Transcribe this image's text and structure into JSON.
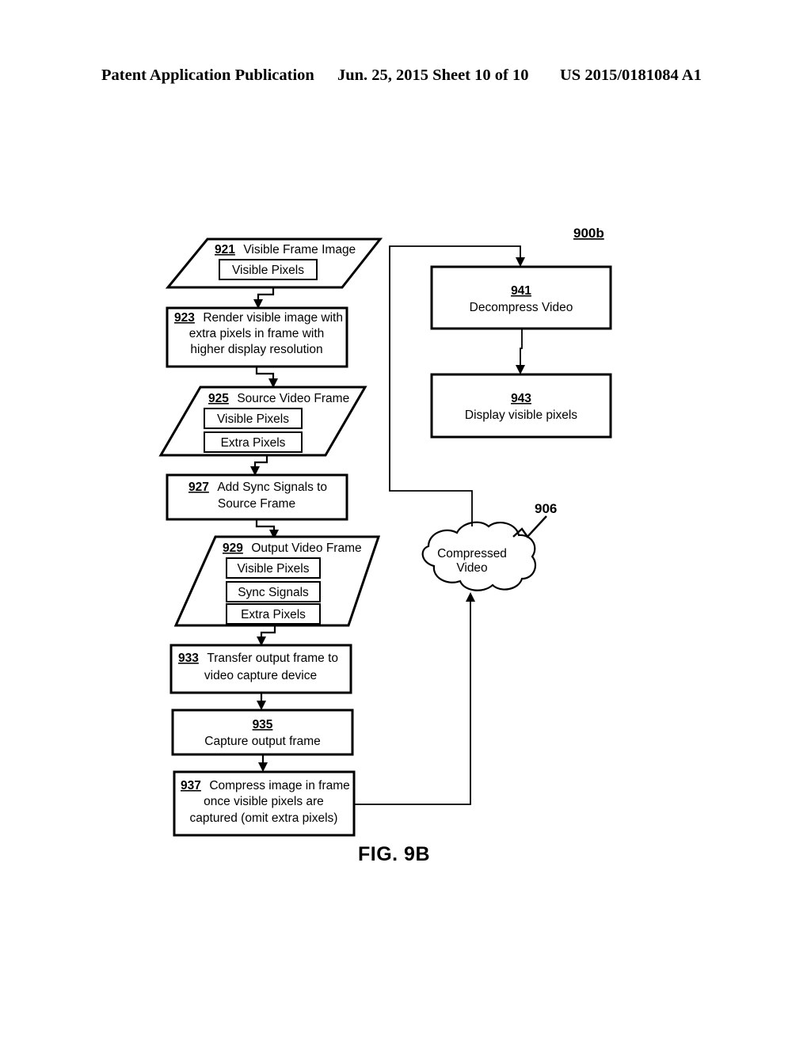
{
  "header": {
    "left": "Patent Application Publication",
    "middle": "Jun. 25, 2015  Sheet 10 of 10",
    "right": "US 2015/0181084 A1"
  },
  "figure": {
    "caption": "FIG. 9B",
    "diagram_tag": "900b",
    "cloud_tag": "906"
  },
  "nodes": {
    "n921": {
      "ref": "921",
      "title": "Visible Frame Image",
      "items": [
        "Visible Pixels"
      ]
    },
    "n923": {
      "ref": "923",
      "lines": [
        "Render visible image with",
        "extra pixels in frame with",
        "higher display resolution"
      ]
    },
    "n925": {
      "ref": "925",
      "title": "Source Video Frame",
      "items": [
        "Visible Pixels",
        "Extra Pixels"
      ]
    },
    "n927": {
      "ref": "927",
      "lines": [
        "Add Sync Signals to",
        "Source Frame"
      ]
    },
    "n929": {
      "ref": "929",
      "title": "Output Video Frame",
      "items": [
        "Visible Pixels",
        "Sync Signals",
        "Extra Pixels"
      ]
    },
    "n933": {
      "ref": "933",
      "lines": [
        "Transfer output frame to",
        "video capture device"
      ]
    },
    "n935": {
      "ref": "935",
      "lines": [
        "Capture output frame"
      ]
    },
    "n937": {
      "ref": "937",
      "lines": [
        "Compress image in frame",
        "once visible pixels are",
        "captured (omit extra pixels)"
      ]
    },
    "n941": {
      "ref": "941",
      "lines": [
        "Decompress Video"
      ]
    },
    "n943": {
      "ref": "943",
      "lines": [
        "Display visible pixels"
      ]
    },
    "cloud": {
      "lines": [
        "Compressed",
        "Video"
      ]
    }
  },
  "colors": {
    "ink": "#000000",
    "paper": "#ffffff"
  }
}
